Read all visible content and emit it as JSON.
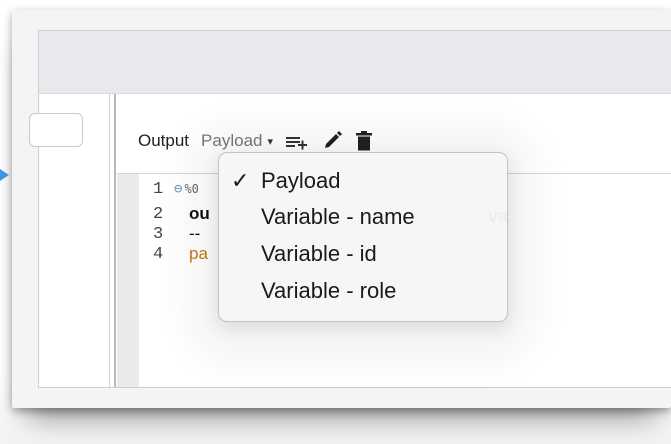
{
  "editor": {
    "toolbar": {
      "output_label": "Output",
      "payload_select": "Payload",
      "caret": "▾"
    },
    "lines": [
      {
        "num": "1",
        "text": "%0",
        "folded_icon": "minus-circle-icon"
      },
      {
        "num": "2",
        "text": "ou"
      },
      {
        "num": "3",
        "text": "--"
      },
      {
        "num": "4",
        "text": "pa"
      }
    ],
    "right_fragment": "va"
  },
  "dropdown": {
    "selected_check": "✓",
    "items": [
      {
        "label": "Payload",
        "selected": true
      },
      {
        "label": "Variable - name",
        "selected": false
      },
      {
        "label": "Variable - id",
        "selected": false
      },
      {
        "label": "Variable - role",
        "selected": false
      }
    ]
  },
  "colors": {
    "accent_arrow": "#3a95e6",
    "keyword_orange": "#c07a10",
    "fold_icon": "#6c8ab8"
  },
  "icons": [
    "add-list-icon",
    "pencil-icon",
    "trash-icon",
    "minus-circle-icon",
    "caret-down-icon",
    "checkmark-icon"
  ]
}
